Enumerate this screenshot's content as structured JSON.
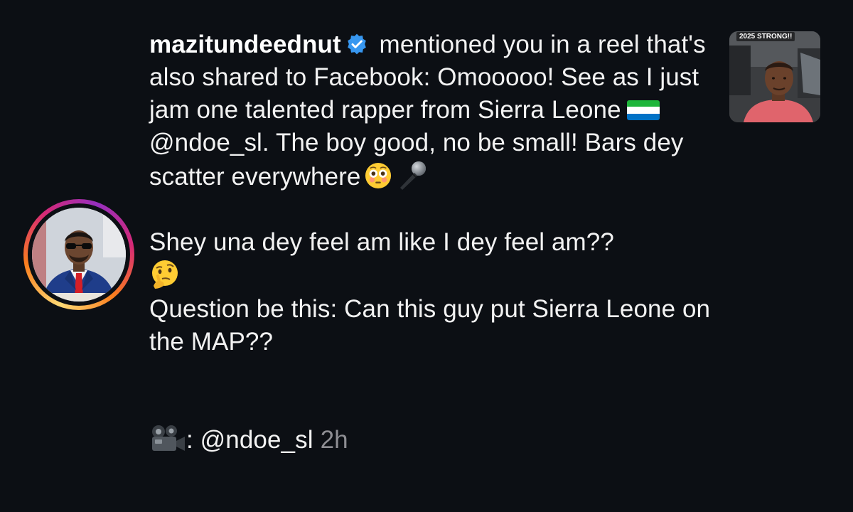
{
  "notification": {
    "username": "mazitundeednut",
    "verified": true,
    "action_text": " mentioned you in a reel that's also shared to Facebook:",
    "caption_line1": "Omooooo! See as I just jam one talented rapper from Sierra Leone",
    "flag_icon": "sierra-leone-flag",
    "mention_1": "@ndoe_sl.",
    "caption_line2": "The boy good, no be small! Bars dey scatter everywhere",
    "emoji_1": "flushed-face-emoji",
    "emoji_2": "microphone-emoji",
    "caption_line3": "Shey una dey feel am like I dey feel am??",
    "emoji_3": "thinking-face-emoji",
    "caption_line4": "Question be this: Can this guy put Sierra Leone on the MAP??",
    "credit_icon": "movie-camera-emoji",
    "credit_text": ": @ndoe_sl",
    "timestamp": "2h"
  },
  "thumbnail": {
    "caption": "2025 STRONG!!"
  },
  "colors": {
    "background": "#0c0f14",
    "text": "#f2f2f2",
    "timestamp": "#8e8e93",
    "verified_badge": "#3797f0"
  }
}
